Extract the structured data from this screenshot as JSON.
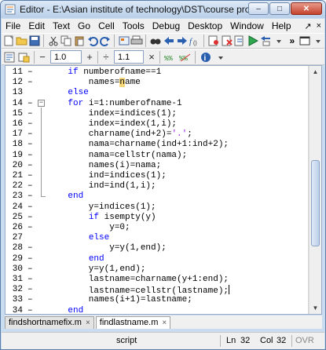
{
  "window": {
    "title": "Editor - E:\\Asian institute of technology\\DST\\course project\\Result\\findshor...",
    "buttons": {
      "minimize": "–",
      "maximize": "□",
      "close": "✕"
    }
  },
  "menu": {
    "items": [
      "File",
      "Edit",
      "Text",
      "Go",
      "Cell",
      "Tools",
      "Debug",
      "Desktop",
      "Window",
      "Help"
    ],
    "right": {
      "dock": "»",
      "undock": "↗",
      "close": "×"
    }
  },
  "toolbar1": {
    "icons": [
      "new-file-icon",
      "open-folder-icon",
      "save-icon",
      "cut-icon",
      "copy-icon",
      "paste-icon",
      "undo-icon",
      "redo-icon",
      "workspace-icon",
      "print-icon",
      "find-icon",
      "back-icon",
      "forward-icon",
      "function-icon",
      "breakpoint-icon",
      "clear-breakpoints-icon",
      "run-icon",
      "stack-icon"
    ],
    "run_label": "▶",
    "overflow": "»"
  },
  "toolbar2": {
    "minus": "−",
    "field1": "1.0",
    "plus": "+",
    "divide": "÷",
    "field2": "1.1",
    "times": "×"
  },
  "editor": {
    "lines": [
      {
        "n": "11",
        "dash": "–",
        "fold": "",
        "html": "    <span class=\"kw\">if</span> numberofname==1"
      },
      {
        "n": "12",
        "dash": "–",
        "fold": "",
        "html": "        names=<span class=\"hl\">n</span>ame"
      },
      {
        "n": "13",
        "dash": "",
        "fold": "",
        "html": "    <span class=\"kw\">else</span>"
      },
      {
        "n": "14",
        "dash": "–",
        "fold": "−",
        "html": "    <span class=\"kw\">for</span> i=1:numberofname-1"
      },
      {
        "n": "15",
        "dash": "–",
        "fold": "",
        "html": "        index=indices(1);"
      },
      {
        "n": "16",
        "dash": "–",
        "fold": "",
        "html": "        index=index(1,i);"
      },
      {
        "n": "17",
        "dash": "–",
        "fold": "",
        "html": "        charname(ind+2)=<span class=\"str\">'.'</span>;"
      },
      {
        "n": "18",
        "dash": "–",
        "fold": "",
        "html": "        nama=charname(ind+1:ind+2);"
      },
      {
        "n": "19",
        "dash": "–",
        "fold": "",
        "html": "        nama=cellstr(nama);"
      },
      {
        "n": "20",
        "dash": "–",
        "fold": "",
        "html": "        names(i)=nama;"
      },
      {
        "n": "21",
        "dash": "–",
        "fold": "",
        "html": "        ind=indices(1);"
      },
      {
        "n": "22",
        "dash": "–",
        "fold": "",
        "html": "        ind=ind(1,i);"
      },
      {
        "n": "23",
        "dash": "–",
        "fold": "",
        "html": "    <span class=\"kw\">end</span>"
      },
      {
        "n": "24",
        "dash": "–",
        "fold": "",
        "html": "        y=indices(1);"
      },
      {
        "n": "25",
        "dash": "–",
        "fold": "",
        "html": "        <span class=\"kw\">if</span> isempty(y)"
      },
      {
        "n": "26",
        "dash": "–",
        "fold": "",
        "html": "            y=0;"
      },
      {
        "n": "27",
        "dash": "",
        "fold": "",
        "html": "        <span class=\"kw\">else</span>"
      },
      {
        "n": "28",
        "dash": "–",
        "fold": "",
        "html": "            y=y(1,end);"
      },
      {
        "n": "29",
        "dash": "–",
        "fold": "",
        "html": "        <span class=\"kw\">end</span>"
      },
      {
        "n": "30",
        "dash": "–",
        "fold": "",
        "html": "        y=y(1,end);"
      },
      {
        "n": "31",
        "dash": "–",
        "fold": "",
        "html": "        lastname=charname(y+1:end);"
      },
      {
        "n": "32",
        "dash": "–",
        "fold": "",
        "html": "        lastname=cellstr(lastname);<span class=\"cursor\"></span>"
      },
      {
        "n": "33",
        "dash": "–",
        "fold": "",
        "html": "        names(i+1)=lastname;"
      },
      {
        "n": "34",
        "dash": "–",
        "fold": "",
        "html": "    <span class=\"kw\">end</span>"
      }
    ]
  },
  "tabs": [
    {
      "label": "findshortnamefix.m",
      "close": "×",
      "active": false
    },
    {
      "label": "findlastname.m",
      "close": "×",
      "active": true
    }
  ],
  "status": {
    "mode": "script",
    "ln_label": "Ln",
    "ln_value": "32",
    "col_label": "Col",
    "col_value": "32",
    "ovr": "OVR"
  }
}
